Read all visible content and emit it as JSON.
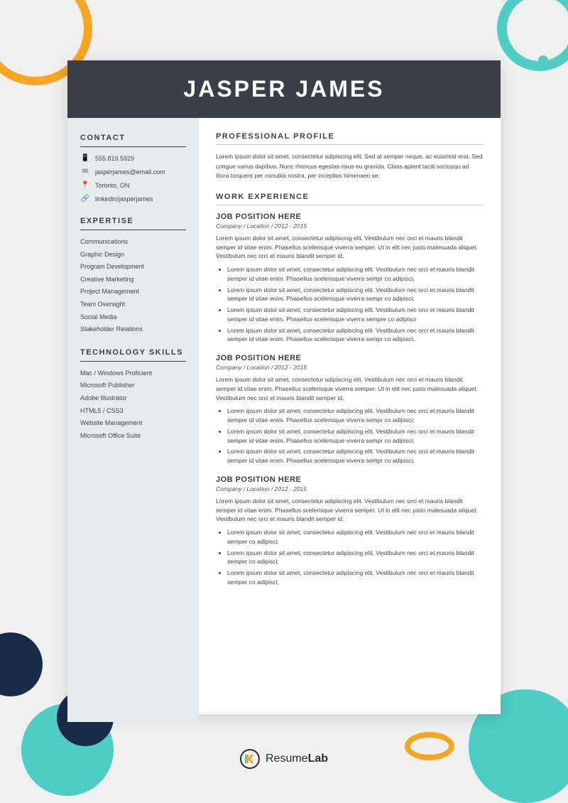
{
  "background": {
    "shapes": []
  },
  "resume": {
    "header": {
      "name": "JASPER JAMES"
    },
    "sidebar": {
      "contact_title": "CONTACT",
      "contact_items": [
        {
          "icon": "phone",
          "text": "555.819.5929"
        },
        {
          "icon": "email",
          "text": "jasperjames@email.com"
        },
        {
          "icon": "location",
          "text": "Toronto, ON"
        },
        {
          "icon": "linkedin",
          "text": "linkedin/jasperjames"
        }
      ],
      "expertise_title": "EXPERTISE",
      "expertise_items": [
        "Communications",
        "Graphic Design",
        "Program Development",
        "Creative Marketing",
        "Project Management",
        "Team Oversight",
        "Social Media",
        "Stakeholder Relations"
      ],
      "tech_title": "TECHNOLOGY SKILLS",
      "tech_items": [
        "Mac / Windows Proficient",
        "Microsoft Publisher",
        "Adobe Illustrator",
        "HTML5 / CSS3",
        "Website Management",
        "Microsoft Office Suite"
      ]
    },
    "main": {
      "profile_title": "PROFESSIONAL PROFILE",
      "profile_text": "Lorem ipsum dolor sit amet, consectetur adipiscing elit. Sed at semper neque, ac euismod erat. Sed congue varius dapibus. Nunc rhoncus egestas risus eu gravida. Class aptent taciti sociosqu ad litora torquent per conubia nostra, per incepitos himenaeo se.",
      "work_title": "WORK EXPERIENCE",
      "jobs": [
        {
          "title": "JOB POSITION HERE",
          "company": "Company / Location / 2012 - 2015",
          "description": "Lorem ipsum dolor sit amet, consectetur adipiscing elit. Vestibulum nec orci et mauris blandit semper id vitae enim. Phasellus scelerisque viverra semper. Ut in elit nec justo malesuada aliquet. Vestibulum nec orci et mauris blandit semper id.",
          "bullets": [
            "Lorem ipsum dolor sit amet, consectetur adipiscing elit. Vestibulum nec orci et mauris blandit semper id vitae enim. Phasellus scelerisque viverra sempr co adipisci;",
            "Lorem ipsum dolor sit amet, consectetur adipiscing elit. Vestibulum nec orci et mauris blandit semper id vitae enim. Phasellus scelerisque viverra sempr co adipisci;",
            "Lorem ipsum dolor sit amet, consectetur adipiscing elit. Vestibulum nec orci et mauris blandit semper id vitae enim. Phasellus scelerisque viverra sempre co adipisci",
            "Lorem ipsum dolor sit amet, consectetur adipiscing elit. Vestibulum nec orci et mauris blandit semper id vitae enim. Phasellus scelerisque viverra sempr co adipisci;."
          ]
        },
        {
          "title": "JOB POSITION HERE",
          "company": "Company / Location /  2012 - 2015",
          "description": "Lorem ipsum dolor sit amet, consectetur adipiscing elit. Vestibulum nec orci et mauris blandit semper id vitae enim. Phasellus scelerisque viverra semper. Ut in elit nec justo malesuada aliquet. Vestibulum nec orci et mauris blandit semper id.",
          "bullets": [
            "Lorem ipsum dolor sit amet, consectetur adipiscing elit. Vestibulum nec orci et mauris blandit semper id vitae enim. Phasellus scelerisque viverra sempr co adipisci;",
            "Lorem ipsum dolor sit amet, consectetur adipiscing elit. Vestibulum nec orci et mauris blandit semper id vitae enim. Phasellus scelerisque viverra sempr co adipisci;",
            "Lorem ipsum dolor sit amet, consectetur adipiscing elit. Vestibulum nec orci et mauris blandit semper id vitae enim. Phasellus scelerisque viverra sempr co adipisci;"
          ]
        },
        {
          "title": "JOB POSITION HERE",
          "company": "Company / Location / 2012 - 2015",
          "description": "Lorem ipsum dolor sit amet, consectetur adipiscing elit. Vestibulum nec orci et mauris blandit semper id vitae enim. Phasellus scelerisque viverra semper. Ut in elit nec justo malesuada aliquet. Vestibulum nec orci et mauris blandit semper id.",
          "bullets": [
            "Lorem ipsum dolor sit amet, consectetur adipiscing elit. Vestibulum nec orci et mauris blandit semper co adipisci;",
            "Lorem ipsum dolor sit amet, consectetur adipiscing elit. Vestibulum nec orci et mauris blandit semper co adipisci;",
            "Lorem ipsum dolor sit amet, consectetur adipiscing elit. Vestibulum nec orci et mauris blandit semper co adipisci;"
          ]
        }
      ]
    }
  },
  "branding": {
    "name": "ResumeLab"
  }
}
